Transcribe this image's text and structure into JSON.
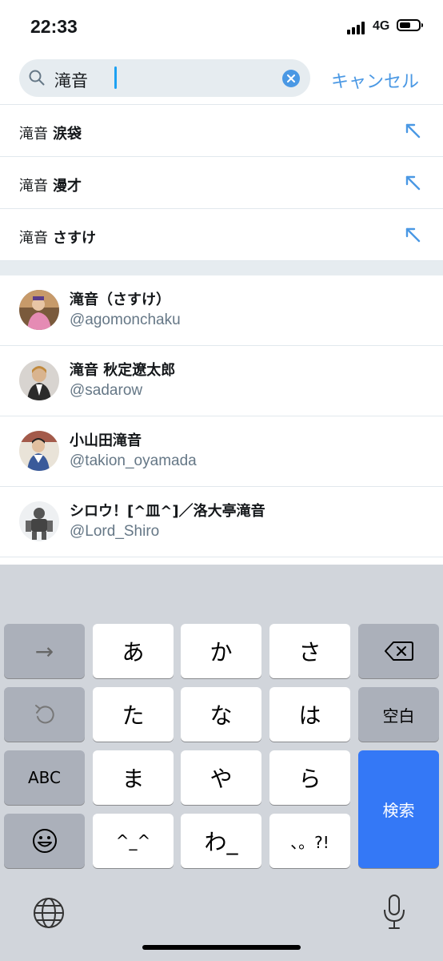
{
  "status": {
    "time": "22:33",
    "network": "4G"
  },
  "search": {
    "query": "滝音",
    "cancel_label": "キャンセル"
  },
  "suggestions": [
    {
      "base": "滝音",
      "term": "涙袋"
    },
    {
      "base": "滝音",
      "term": "漫才"
    },
    {
      "base": "滝音",
      "term": "さすけ"
    }
  ],
  "users": [
    {
      "name": "滝音（さすけ）",
      "handle": "@agomonchaku"
    },
    {
      "name": "滝音 秋定遼太郎",
      "handle": "@sadarow"
    },
    {
      "name": "小山田滝音",
      "handle": "@takion_oyamada"
    },
    {
      "name": "シロウ！[^皿^]／洛大亭滝音",
      "handle": "@Lord_Shiro"
    }
  ],
  "keyboard": {
    "row1": [
      "→",
      "あ",
      "か",
      "さ",
      "backspace"
    ],
    "row2": [
      "undo",
      "た",
      "な",
      "は",
      "空白"
    ],
    "row3": [
      "ABC",
      "ま",
      "や",
      "ら"
    ],
    "row4": [
      "emoji",
      "^_^",
      "わ_",
      "、。?!"
    ],
    "search_label": "検索"
  },
  "colors": {
    "accent": "#4a98e4",
    "search_key": "#3478f6",
    "keyboard_bg": "#d1d5db"
  },
  "icons": [
    "search-icon",
    "clear-icon",
    "arrow-up-left-icon",
    "backspace-icon",
    "undo-icon",
    "emoji-icon",
    "globe-icon",
    "mic-icon"
  ]
}
